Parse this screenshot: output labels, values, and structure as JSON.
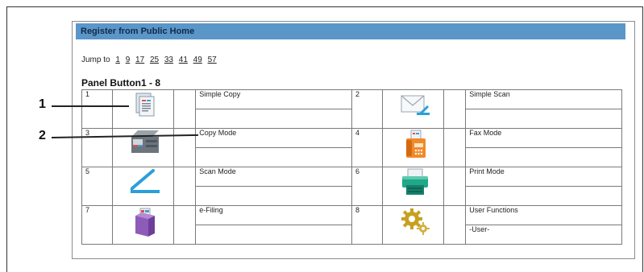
{
  "header": {
    "title": "Register from Public Home"
  },
  "jump": {
    "label": "Jump to",
    "links": [
      "1",
      "9",
      "17",
      "25",
      "33",
      "41",
      "49",
      "57"
    ]
  },
  "panel": {
    "title": "Panel Button1 - 8"
  },
  "buttons": [
    {
      "num": "1",
      "name": "Simple Copy",
      "sub": "",
      "icon": "simple-copy-icon"
    },
    {
      "num": "2",
      "name": "Simple Scan",
      "sub": "",
      "icon": "simple-scan-icon"
    },
    {
      "num": "3",
      "name": "Copy Mode",
      "sub": "",
      "icon": "copy-mode-icon"
    },
    {
      "num": "4",
      "name": "Fax Mode",
      "sub": "",
      "icon": "fax-mode-icon"
    },
    {
      "num": "5",
      "name": "Scan Mode",
      "sub": "",
      "icon": "scan-mode-icon"
    },
    {
      "num": "6",
      "name": "Print Mode",
      "sub": "",
      "icon": "print-mode-icon"
    },
    {
      "num": "7",
      "name": "e-Filing",
      "sub": "",
      "icon": "e-filing-icon"
    },
    {
      "num": "8",
      "name": "User Functions",
      "sub": "-User-",
      "icon": "user-functions-icon"
    }
  ],
  "callouts": [
    "1",
    "2"
  ],
  "colors": {
    "header_bg": "#5b96c9",
    "accent_blue": "#2aa0d8"
  }
}
